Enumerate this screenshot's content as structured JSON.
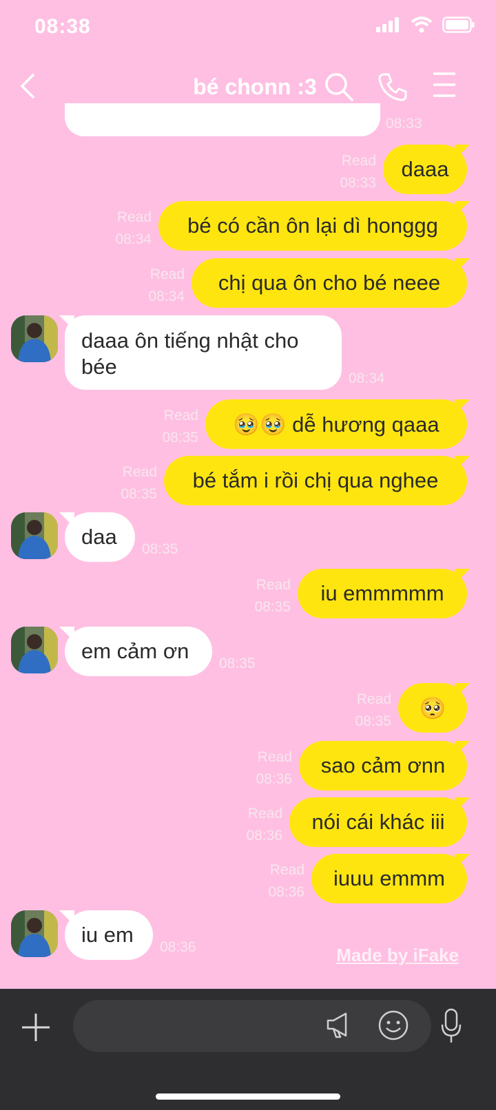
{
  "status": {
    "time": "08:38"
  },
  "header": {
    "title": "bé chonn :3"
  },
  "partial_top": {
    "time": "08:33"
  },
  "messages": [
    {
      "text": "daaa",
      "read": "Read",
      "time": "08:33"
    },
    {
      "text": "bé có cần ôn lại dì honggg",
      "read": "Read",
      "time": "08:34"
    },
    {
      "text": "chị qua ôn cho bé neee",
      "read": "Read",
      "time": "08:34"
    },
    {
      "line1": "daaa ôn tiếng nhật cho",
      "line2": "bée",
      "time": "08:34"
    },
    {
      "text": "🥹🥹 dễ hương qaaa",
      "read": "Read",
      "time": "08:35"
    },
    {
      "text": "bé tắm i rồi chị qua nghee",
      "read": "Read",
      "time": "08:35"
    },
    {
      "text": "daa",
      "time": "08:35"
    },
    {
      "text": "iu emmmmm",
      "read": "Read",
      "time": "08:35"
    },
    {
      "text": "em cảm ơn",
      "time": "08:35"
    },
    {
      "text": "🥺",
      "read": "Read",
      "time": "08:35"
    },
    {
      "text": "sao cảm ơnn",
      "read": "Read",
      "time": "08:36"
    },
    {
      "text": "nói cái khác iii",
      "read": "Read",
      "time": "08:36"
    },
    {
      "text": "iuuu emmm",
      "read": "Read",
      "time": "08:36"
    },
    {
      "text": "iu em",
      "time": "08:36"
    }
  ],
  "watermark": "Made by iFake",
  "icons": [
    "back-chevron-icon",
    "search-icon",
    "phone-icon",
    "menu-icon",
    "plus-icon",
    "megaphone-icon",
    "emoji-icon",
    "microphone-icon"
  ],
  "colors": {
    "background": "#ffbfe2",
    "sent_bubble": "#ffe510",
    "received_bubble": "#ffffff",
    "input_bar": "#2e2e30"
  }
}
